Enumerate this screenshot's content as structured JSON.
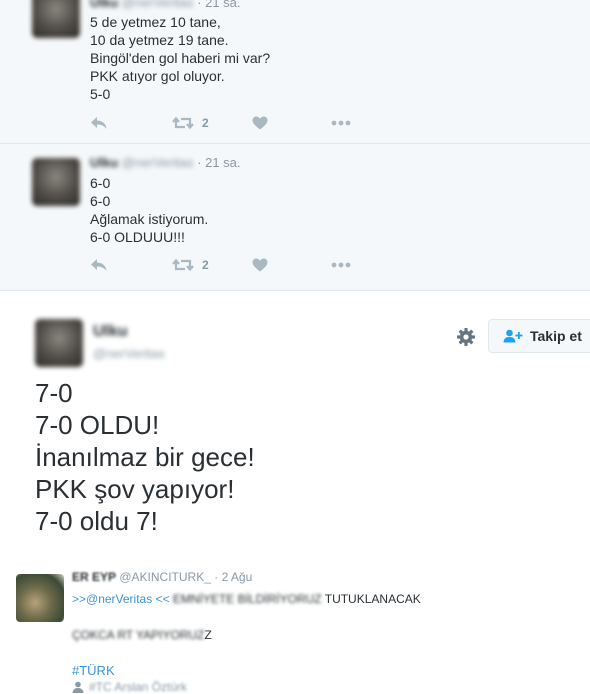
{
  "thread": {
    "replies": [
      {
        "name": "Ulku",
        "handle": "@nerVeritas",
        "time": "· 21 sa.",
        "lines": [
          "5 de yetmez 10 tane,",
          "10 da yetmez 19 tane.",
          "Bingöl'den gol haberi mi var?",
          "PKK atıyor gol oluyor.",
          "5-0"
        ],
        "retweets": "2"
      },
      {
        "name": "Ulku",
        "handle": "@nerVeritas",
        "time": "· 21 sa.",
        "lines": [
          "6-0",
          "6-0",
          "Ağlamak istiyorum.",
          "6-0 OLDUUU!!!"
        ],
        "retweets": "2"
      }
    ]
  },
  "main": {
    "name": "Ulku",
    "handle": "@nerVeritas",
    "follow_label": "Takip et",
    "lines": [
      "7-0",
      "7-0 OLDU!",
      "İnanılmaz bir gece!",
      "PKK şov yapıyor!",
      "7-0 oldu 7!"
    ]
  },
  "quote": {
    "name": "ER EYP",
    "handle": "@AKINCITURK_",
    "time": "· 2 Ağu",
    "line1_prefix": ">>@nerVeritas <<",
    "line1_blurred": "EMNİYETE BİLDİRİYORUZ",
    "line1_suffix": "TUTUKLANACAK",
    "line2_blurred": "ÇOKCA RT YAPIYORUZ",
    "line2_suffix": "Z",
    "hashtag": "#TÜRK",
    "user_line": "#TC Arslan Öztürk"
  }
}
